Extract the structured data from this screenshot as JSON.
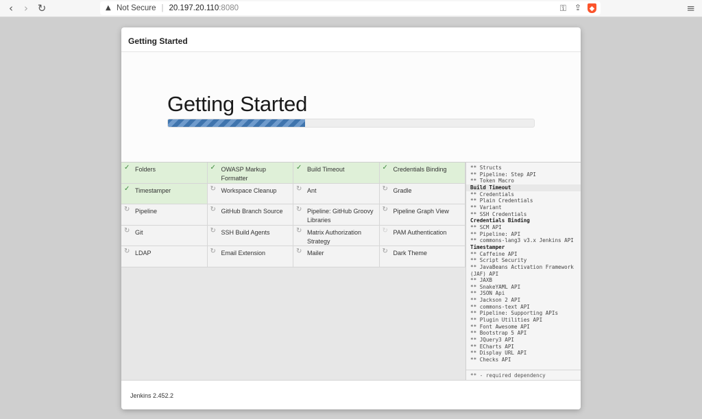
{
  "browser": {
    "not_secure": "Not Secure",
    "url_host": "20.197.20.110",
    "url_port": ":8080"
  },
  "dialog": {
    "header_title": "Getting Started",
    "hero_title": "Getting Started",
    "progress": 0.375,
    "footer_version": "Jenkins 2.452.2"
  },
  "plugins": [
    {
      "label": "Folders",
      "status": "done"
    },
    {
      "label": "OWASP Markup Formatter",
      "status": "done"
    },
    {
      "label": "Build Timeout",
      "status": "done"
    },
    {
      "label": "Credentials Binding",
      "status": "done"
    },
    {
      "label": "Timestamper",
      "status": "done"
    },
    {
      "label": "Workspace Cleanup",
      "status": "pending"
    },
    {
      "label": "Ant",
      "status": "pending"
    },
    {
      "label": "Gradle",
      "status": "pending"
    },
    {
      "label": "Pipeline",
      "status": "pending"
    },
    {
      "label": "GitHub Branch Source",
      "status": "pending"
    },
    {
      "label": "Pipeline: GitHub Groovy Libraries",
      "status": "pending"
    },
    {
      "label": "Pipeline Graph View",
      "status": "pending"
    },
    {
      "label": "Git",
      "status": "pending"
    },
    {
      "label": "SSH Build Agents",
      "status": "pending"
    },
    {
      "label": "Matrix Authorization Strategy",
      "status": "pending"
    },
    {
      "label": "PAM Authentication",
      "status": "waiting"
    },
    {
      "label": "LDAP",
      "status": "pending"
    },
    {
      "label": "Email Extension",
      "status": "pending"
    },
    {
      "label": "Mailer",
      "status": "pending"
    },
    {
      "label": "Dark Theme",
      "status": "pending"
    }
  ],
  "log": {
    "lines": [
      {
        "text": "** Structs",
        "kind": "dep"
      },
      {
        "text": "** Pipeline: Step API",
        "kind": "dep"
      },
      {
        "text": "** Token Macro",
        "kind": "dep"
      },
      {
        "text": "Build Timeout",
        "kind": "head-hl"
      },
      {
        "text": "** Credentials",
        "kind": "dep"
      },
      {
        "text": "** Plain Credentials",
        "kind": "dep"
      },
      {
        "text": "** Variant",
        "kind": "dep"
      },
      {
        "text": "** SSH Credentials",
        "kind": "dep"
      },
      {
        "text": "Credentials Binding",
        "kind": "head"
      },
      {
        "text": "** SCM API",
        "kind": "dep"
      },
      {
        "text": "** Pipeline: API",
        "kind": "dep"
      },
      {
        "text": "** commons-lang3 v3.x Jenkins API",
        "kind": "dep"
      },
      {
        "text": "Timestamper",
        "kind": "head"
      },
      {
        "text": "** Caffeine API",
        "kind": "dep"
      },
      {
        "text": "** Script Security",
        "kind": "dep"
      },
      {
        "text": "** JavaBeans Activation Framework (JAF) API",
        "kind": "dep"
      },
      {
        "text": "** JAXB",
        "kind": "dep"
      },
      {
        "text": "** SnakeYAML API",
        "kind": "dep"
      },
      {
        "text": "** JSON Api",
        "kind": "dep"
      },
      {
        "text": "** Jackson 2 API",
        "kind": "dep"
      },
      {
        "text": "** commons-text API",
        "kind": "dep"
      },
      {
        "text": "** Pipeline: Supporting APIs",
        "kind": "dep"
      },
      {
        "text": "** Plugin Utilities API",
        "kind": "dep"
      },
      {
        "text": "** Font Awesome API",
        "kind": "dep"
      },
      {
        "text": "** Bootstrap 5 API",
        "kind": "dep"
      },
      {
        "text": "** JQuery3 API",
        "kind": "dep"
      },
      {
        "text": "** ECharts API",
        "kind": "dep"
      },
      {
        "text": "** Display URL API",
        "kind": "dep"
      },
      {
        "text": "** Checks API",
        "kind": "dep"
      }
    ],
    "footer": "** - required dependency"
  },
  "icons": {
    "done": "check-icon",
    "pending": "spinner-icon",
    "waiting": "spinner-icon"
  },
  "colors": {
    "done_bg": "#dff0d8",
    "progress": "#3f74ad"
  }
}
